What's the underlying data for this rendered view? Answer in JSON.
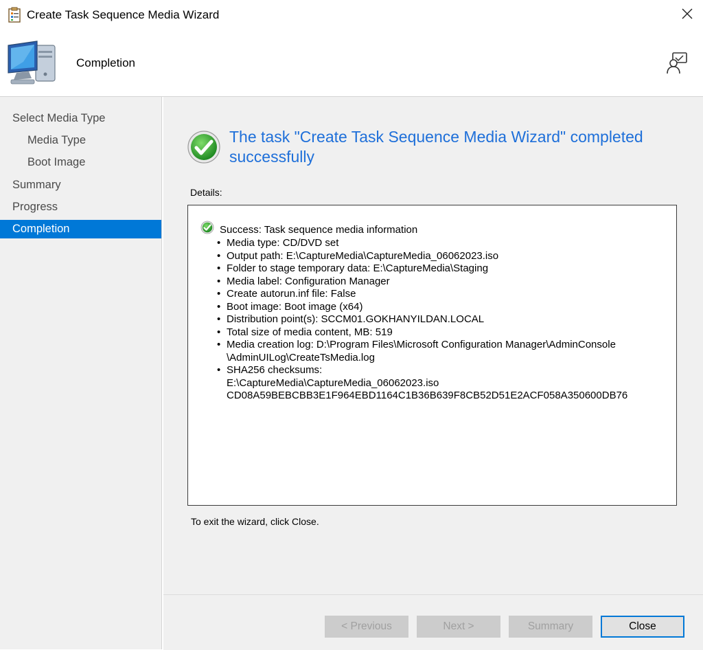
{
  "window": {
    "title": "Create Task Sequence Media Wizard"
  },
  "header": {
    "title": "Completion"
  },
  "sidebar": {
    "items": [
      {
        "label": "Select Media Type",
        "level": 0,
        "active": false
      },
      {
        "label": "Media Type",
        "level": 1,
        "active": false
      },
      {
        "label": "Boot Image",
        "level": 1,
        "active": false
      },
      {
        "label": "Summary",
        "level": 0,
        "active": false
      },
      {
        "label": "Progress",
        "level": 0,
        "active": false
      },
      {
        "label": "Completion",
        "level": 0,
        "active": true
      }
    ]
  },
  "main": {
    "headline": "The task \"Create Task Sequence Media Wizard\" completed successfully",
    "details_label": "Details:",
    "success_text": "Success: Task sequence media information",
    "details": [
      {
        "text": "Media type: CD/DVD set"
      },
      {
        "text": "Output path: E:\\CaptureMedia\\CaptureMedia_06062023.iso"
      },
      {
        "text": "Folder to stage temporary data: E:\\CaptureMedia\\Staging"
      },
      {
        "text": "Media label: Configuration Manager"
      },
      {
        "text": "Create autorun.inf file: False"
      },
      {
        "text": "Boot image: Boot image (x64)"
      },
      {
        "text": "Distribution point(s): SCCM01.GOKHANYILDAN.LOCAL"
      },
      {
        "text": "Total size of media content, MB:  519"
      },
      {
        "text": "Media creation log: D:\\Program Files\\Microsoft Configuration Manager\\AdminConsole",
        "cont": [
          "\\AdminUILog\\CreateTsMedia.log"
        ]
      },
      {
        "text": "SHA256 checksums:",
        "cont": [
          "E:\\CaptureMedia\\CaptureMedia_06062023.iso",
          "CD08A59BEBCBB3E1F964EBD1164C1B36B639F8CB52D51E2ACF058A350600DB76"
        ]
      }
    ],
    "exit_hint": "To exit the wizard, click Close."
  },
  "footer": {
    "previous_label": "< Previous",
    "next_label": "Next >",
    "summary_label": "Summary",
    "close_label": "Close"
  },
  "colors": {
    "accent": "#0078d7",
    "headline": "#1e6fd9",
    "success_green": "#2e9e2e",
    "panel_bg": "#f0f0f0"
  },
  "icons": {
    "title": "wizard-app-icon",
    "close": "close-icon",
    "header": "computer-icon",
    "help": "help-person-icon",
    "success": "success-check-icon"
  }
}
